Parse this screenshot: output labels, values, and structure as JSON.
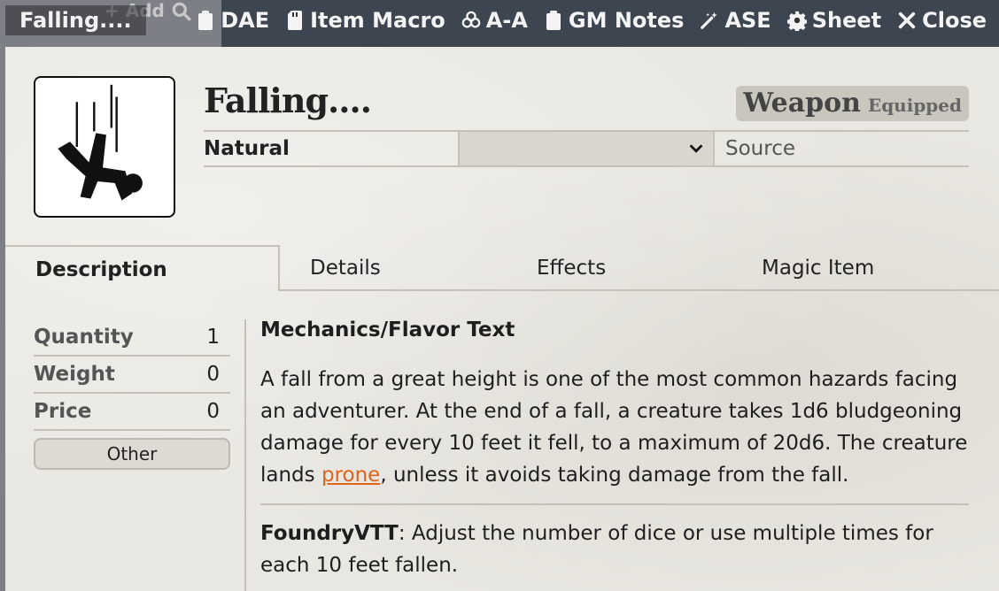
{
  "background": {
    "add_label": "+ Add"
  },
  "window": {
    "title": "Falling...."
  },
  "header_controls": [
    {
      "label": "DAE",
      "icon": "clipboard-icon"
    },
    {
      "label": "Item Macro",
      "icon": "sd-card-icon"
    },
    {
      "label": "A-A",
      "icon": "biohazard-icon"
    },
    {
      "label": "GM Notes",
      "icon": "clipboard-icon"
    },
    {
      "label": "ASE",
      "icon": "magic-wand-icon"
    },
    {
      "label": "Sheet",
      "icon": "gear-icon"
    },
    {
      "label": "Close",
      "icon": "close-icon"
    }
  ],
  "item": {
    "name": "Falling....",
    "type_label": "Weapon",
    "status_label": "Equipped",
    "subtype": "Natural",
    "select_value": "",
    "source_placeholder": "Source"
  },
  "tabs": [
    "Description",
    "Details",
    "Effects",
    "Magic Item"
  ],
  "properties": [
    {
      "label": "Quantity",
      "value": "1"
    },
    {
      "label": "Weight",
      "value": "0"
    },
    {
      "label": "Price",
      "value": "0"
    }
  ],
  "other_button": "Other",
  "description": {
    "heading": "Mechanics/Flavor Text",
    "para1_before": "A fall from a great height is one of the most common hazards facing an adventurer. At the end of a fall, a creature takes 1d6 bludgeoning damage for every 10 feet it fell, to a maximum of 20d6. The creature lands ",
    "para1_link": "prone",
    "para1_after": ", unless it avoids taking damage from the fall.",
    "para2_bold": "FoundryVTT",
    "para2_text": ": Adjust the number of dice or use multiple times for each 10 feet fallen."
  },
  "colors": {
    "link": "#e0641a",
    "sheet_bg": "#e9e7e1"
  }
}
